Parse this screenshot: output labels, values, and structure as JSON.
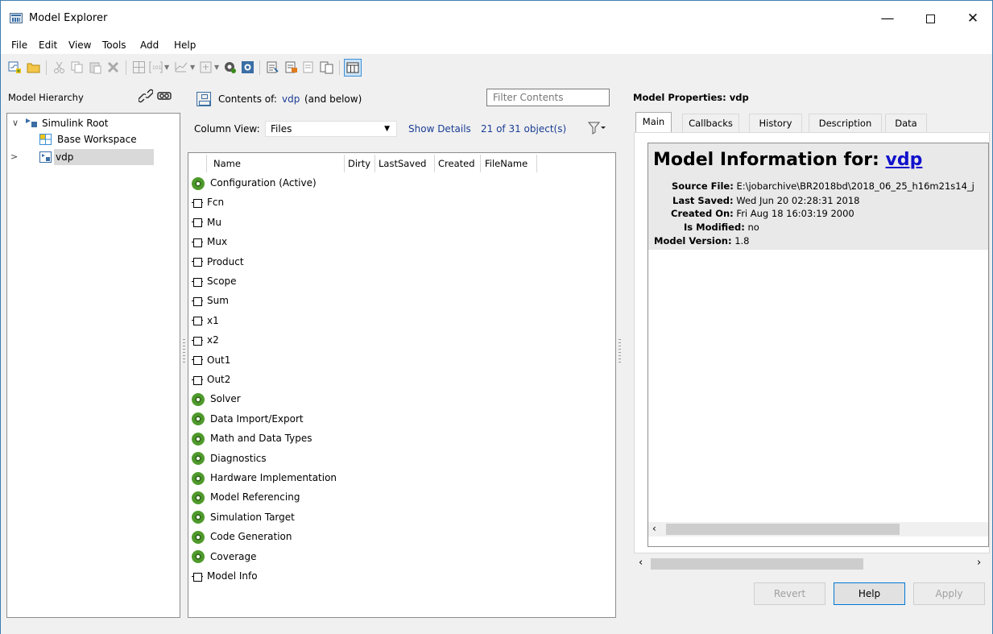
{
  "window": {
    "title": "Model Explorer",
    "minimize": "—",
    "close": "✕"
  },
  "menu": [
    "File",
    "Edit",
    "View",
    "Tools",
    "Add",
    "Help"
  ],
  "hierarchy": {
    "label": "Model Hierarchy",
    "items": [
      {
        "label": "Simulink Root",
        "expanded": true
      },
      {
        "label": "Base Workspace"
      },
      {
        "label": "vdp",
        "selected": true
      }
    ]
  },
  "contents": {
    "prefix": "Contents of:",
    "model_link": "vdp",
    "suffix": "(and below)",
    "filter_placeholder": "Filter Contents",
    "column_view_label": "Column View:",
    "column_view_value": "Files",
    "show_details": "Show Details",
    "object_count": "21 of 31 object(s)",
    "columns": [
      "Name",
      "Dirty",
      "LastSaved",
      "Created",
      "FileName"
    ],
    "rows": [
      {
        "name": "Configuration (Active)",
        "icon": "config-active"
      },
      {
        "name": "Fcn",
        "icon": "block"
      },
      {
        "name": "Mu",
        "icon": "block"
      },
      {
        "name": "Mux",
        "icon": "block"
      },
      {
        "name": "Product",
        "icon": "block"
      },
      {
        "name": "Scope",
        "icon": "block"
      },
      {
        "name": "Sum",
        "icon": "block"
      },
      {
        "name": "x1",
        "icon": "block"
      },
      {
        "name": "x2",
        "icon": "block"
      },
      {
        "name": "Out1",
        "icon": "block"
      },
      {
        "name": "Out2",
        "icon": "block"
      },
      {
        "name": "Solver",
        "icon": "config"
      },
      {
        "name": "Data Import/Export",
        "icon": "config"
      },
      {
        "name": "Math and Data Types",
        "icon": "config"
      },
      {
        "name": "Diagnostics",
        "icon": "config"
      },
      {
        "name": "Hardware Implementation",
        "icon": "config"
      },
      {
        "name": "Model Referencing",
        "icon": "config"
      },
      {
        "name": "Simulation Target",
        "icon": "config"
      },
      {
        "name": "Code Generation",
        "icon": "config"
      },
      {
        "name": "Coverage",
        "icon": "config"
      },
      {
        "name": "Model Info",
        "icon": "block"
      }
    ]
  },
  "properties": {
    "title": "Model Properties: vdp",
    "tabs": [
      "Main",
      "Callbacks",
      "History",
      "Description",
      "Data"
    ],
    "info": {
      "heading": "Model Information for:",
      "model_link": "vdp",
      "source_file_label": "Source File:",
      "source_file": "E:\\jobarchive\\BR2018bd\\2018_06_25_h16m21s14_j",
      "last_saved_label": "Last Saved:",
      "last_saved": "Wed Jun 20 02:28:31 2018",
      "created_on_label": "Created On:",
      "created_on": "Fri Aug 18 16:03:19 2000",
      "is_modified_label": "Is Modified:",
      "is_modified": "no",
      "model_version_label": "Model Version:",
      "model_version": "1.8"
    },
    "buttons": {
      "revert": "Revert",
      "help": "Help",
      "apply": "Apply"
    }
  },
  "colors": {
    "link": "#1a3d95",
    "accent": "#0078d7",
    "selection": "#d9d9d9",
    "config_green": "#4e9a2a"
  }
}
